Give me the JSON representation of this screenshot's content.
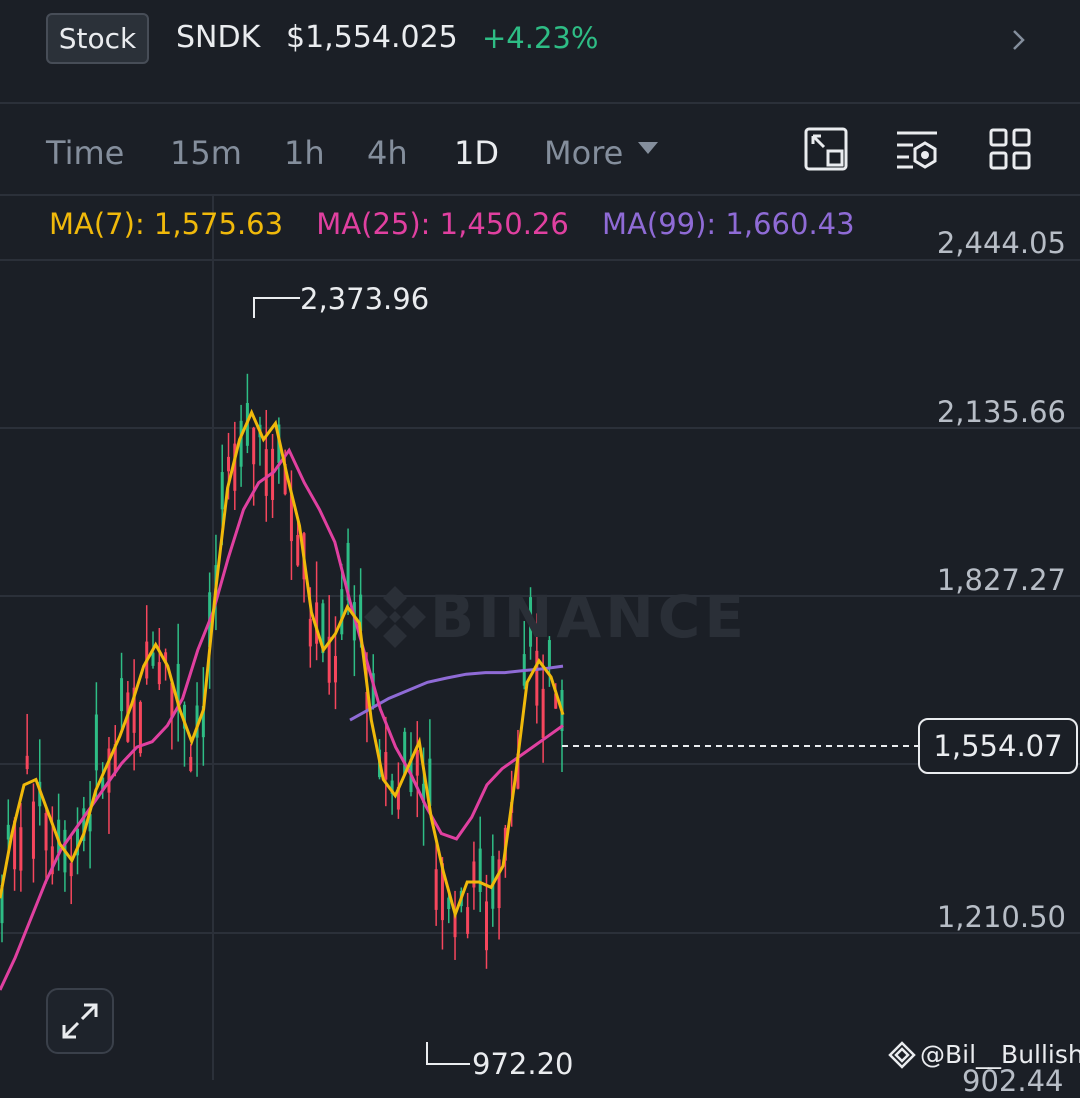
{
  "header": {
    "badge": "Stock",
    "ticker": "SNDK",
    "price": "$1,554.025",
    "change": "+4.23%",
    "change_color": "#2ebd85"
  },
  "timeframes": {
    "time": "Time",
    "m15": "15m",
    "h1": "1h",
    "h4": "4h",
    "d1": "1D",
    "more": "More",
    "active": "1D"
  },
  "ma": {
    "ma7": "MA(7): 1,575.63",
    "ma25": "MA(25): 1,450.26",
    "ma99": "MA(99): 1,660.43",
    "colors": {
      "ma7": "#f0b90b",
      "ma25": "#e040a0",
      "ma99": "#8f6bd6"
    }
  },
  "axis": {
    "labels": [
      "2,444.05",
      "2,135.66",
      "1,827.27",
      "1,210.50"
    ],
    "cut_label": "902.44"
  },
  "markers": {
    "high": "2,373.96",
    "low": "972.20",
    "current": "1,554.07"
  },
  "watermark": "BINANCE",
  "credit": "@Bil__Bullish",
  "chart_data": {
    "type": "line",
    "title": "",
    "y_ticks": [
      2444.05,
      2135.66,
      1827.27,
      1210.5,
      902.44
    ],
    "ylim": [
      902.44,
      2444.05
    ],
    "high": 2373.96,
    "low": 972.2,
    "current": 1554.07,
    "grid": true,
    "series": [
      {
        "name": "MA(7)",
        "color": "#f0b90b",
        "values": [
          1230,
          1350,
          1440,
          1450,
          1390,
          1330,
          1300,
          1350,
          1430,
          1480,
          1530,
          1590,
          1660,
          1700,
          1660,
          1580,
          1520,
          1580,
          1800,
          1990,
          2080,
          2130,
          2080,
          2110,
          2010,
          1920,
          1760,
          1690,
          1720,
          1770,
          1740,
          1560,
          1450,
          1420,
          1470,
          1520,
          1380,
          1280,
          1200,
          1260,
          1260,
          1250,
          1290,
          1450,
          1630,
          1670,
          1640,
          1570
        ]
      },
      {
        "name": "MA(25)",
        "color": "#e040a0",
        "values": [
          1060,
          1120,
          1190,
          1260,
          1320,
          1360,
          1400,
          1440,
          1480,
          1510,
          1520,
          1550,
          1600,
          1690,
          1760,
          1860,
          1950,
          2000,
          2020,
          2060,
          2000,
          1950,
          1890,
          1780,
          1680,
          1580,
          1510,
          1460,
          1400,
          1350,
          1340,
          1380,
          1440,
          1470,
          1490,
          1510,
          1530,
          1550
        ]
      },
      {
        "name": "MA(99)",
        "color": "#8f6bd6",
        "values": [
          1560,
          1580,
          1600,
          1615,
          1630,
          1638,
          1645,
          1648,
          1648,
          1652,
          1655,
          1660
        ]
      }
    ]
  }
}
